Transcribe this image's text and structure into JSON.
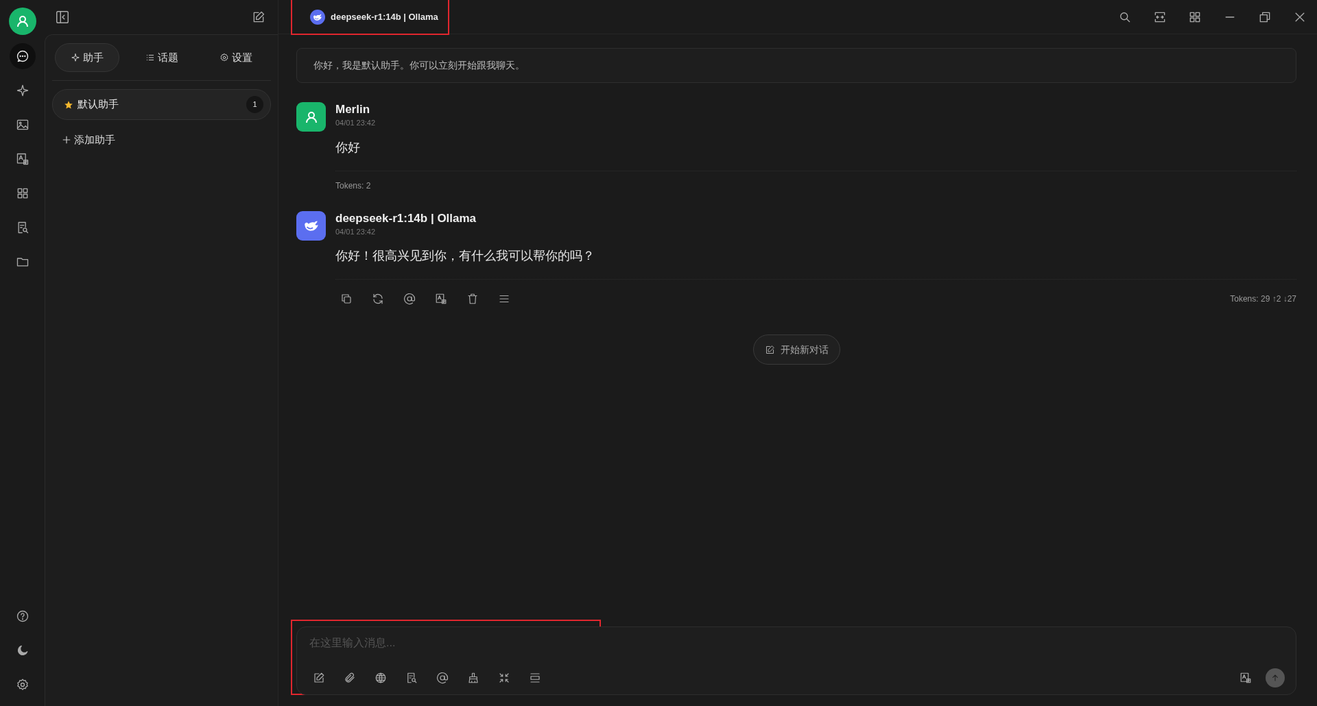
{
  "rail": {
    "items": [
      {
        "kind": "chat",
        "selected": true
      },
      {
        "kind": "sparkle",
        "selected": false
      },
      {
        "kind": "image",
        "selected": false
      },
      {
        "kind": "translate",
        "selected": false
      },
      {
        "kind": "apps",
        "selected": false
      },
      {
        "kind": "docsearch",
        "selected": false
      },
      {
        "kind": "folder",
        "selected": false
      }
    ],
    "bottom": [
      {
        "kind": "help"
      },
      {
        "kind": "moon"
      },
      {
        "kind": "gear"
      }
    ]
  },
  "header": {
    "model": "deepseek-r1:14b | Ollama",
    "highlighted": true,
    "controls": [
      {
        "kind": "search"
      },
      {
        "kind": "fit"
      },
      {
        "kind": "apps"
      },
      {
        "kind": "minimize"
      },
      {
        "kind": "restore"
      },
      {
        "kind": "close"
      }
    ]
  },
  "sidebar": {
    "tabs": [
      {
        "label": "助手",
        "selected": true
      },
      {
        "label": "话题",
        "selected": false
      },
      {
        "label": "设置",
        "selected": false
      }
    ],
    "assistants": [
      {
        "name": "默认助手",
        "count": "1",
        "selected": true
      }
    ],
    "add_label": "添加助手"
  },
  "system_message": "你好，我是默认助手。你可以立刻开始跟我聊天。",
  "messages": [
    {
      "kind": "user",
      "name": "Merlin",
      "time": "04/01 23:42",
      "text": "你好",
      "tokens": "Tokens: 2"
    },
    {
      "kind": "assistant",
      "name": "deepseek-r1:14b | Ollama",
      "time": "04/01 23:42",
      "text": "你好！很高兴见到你，有什么我可以帮你的吗？",
      "tokens": "Tokens: 29 ↑2 ↓27",
      "actions": [
        {
          "kind": "copy"
        },
        {
          "kind": "refresh"
        },
        {
          "kind": "at"
        },
        {
          "kind": "translate"
        },
        {
          "kind": "trash"
        },
        {
          "kind": "menu"
        }
      ]
    }
  ],
  "new_chat": "开始新对话",
  "composer": {
    "placeholder": "在这里输入消息...",
    "highlighted": true,
    "tools": [
      {
        "kind": "edit"
      },
      {
        "kind": "clip"
      },
      {
        "kind": "globe"
      },
      {
        "kind": "docsearch"
      },
      {
        "kind": "at"
      },
      {
        "kind": "broom"
      },
      {
        "kind": "collapse"
      },
      {
        "kind": "lines"
      }
    ],
    "right_tools": [
      {
        "kind": "translate"
      }
    ]
  }
}
